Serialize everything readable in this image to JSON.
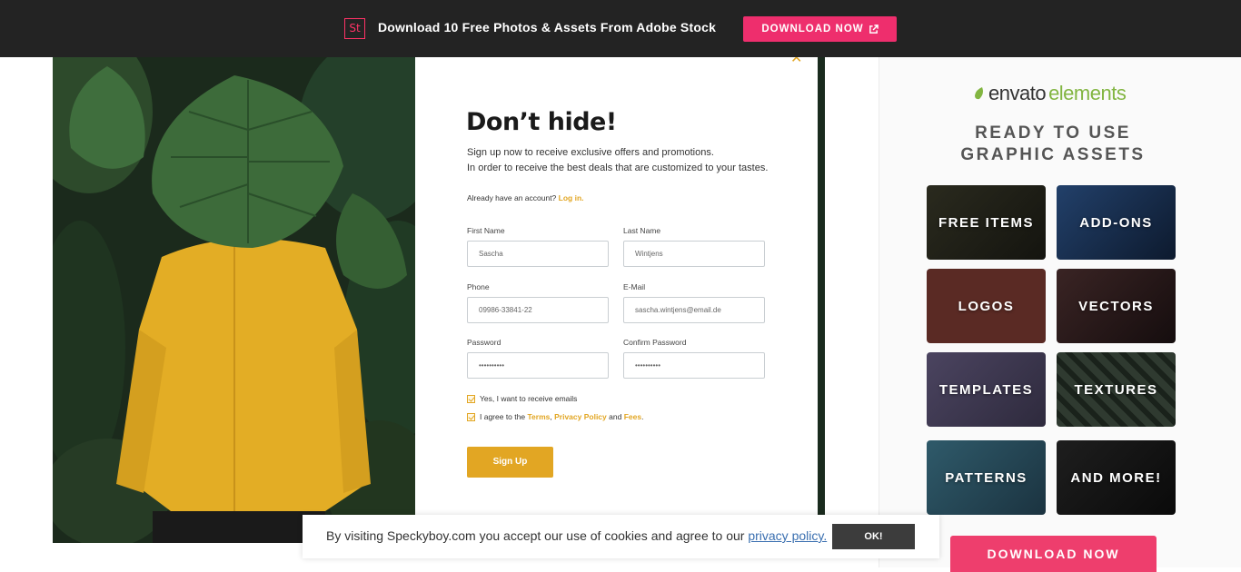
{
  "banner": {
    "logo_text": "St",
    "message": "Download 10 Free Photos & Assets From Adobe Stock",
    "button_label": "DOWNLOAD NOW",
    "button_icon": "external-link-icon",
    "accent": "#ee2e6d"
  },
  "form": {
    "close_icon": "close-icon",
    "title": "Don’t hide!",
    "subtitle_line1": "Sign up now to receive exclusive offers and promotions.",
    "subtitle_line2": "In order to receive the best deals that are customized to your tastes.",
    "account_prompt": "Already have an account?",
    "login_link": "Log in.",
    "fields": {
      "first_name": {
        "label": "First Name",
        "value": "Sascha"
      },
      "last_name": {
        "label": "Last Name",
        "value": "Wintjens"
      },
      "phone": {
        "label": "Phone",
        "value": "09986-33841-22"
      },
      "email": {
        "label": "E-Mail",
        "value": "sascha.wintjens@email.de"
      },
      "password": {
        "label": "Password",
        "value": "••••••••••"
      },
      "confirm_password": {
        "label": "Confirm Password",
        "value": "••••••••••"
      }
    },
    "check_emails": "Yes, I want to receive emails",
    "terms": {
      "prefix": "I agree to the",
      "terms_link": "Terms",
      "comma": ",",
      "privacy_link": "Privacy Policy",
      "and": "and",
      "fees_link": "Fees",
      "period": "."
    },
    "submit_label": "Sign Up",
    "accent": "#e2a623"
  },
  "sidebar": {
    "brand_envato": "envato",
    "brand_elements": "elements",
    "headline_line1": "READY TO USE",
    "headline_line2": "GRAPHIC ASSETS",
    "tiles": [
      {
        "label": "FREE ITEMS"
      },
      {
        "label": "ADD-ONS"
      },
      {
        "label": "LOGOS"
      },
      {
        "label": "VECTORS"
      },
      {
        "label": "TEMPLATES"
      },
      {
        "label": "TEXTURES"
      },
      {
        "label": "PATTERNS"
      },
      {
        "label": "AND MORE!"
      }
    ],
    "button_label": "DOWNLOAD NOW"
  },
  "cookie": {
    "text": "By visiting Speckyboy.com you accept our use of cookies and agree to our",
    "link": "privacy policy.",
    "button_label": "OK!"
  }
}
